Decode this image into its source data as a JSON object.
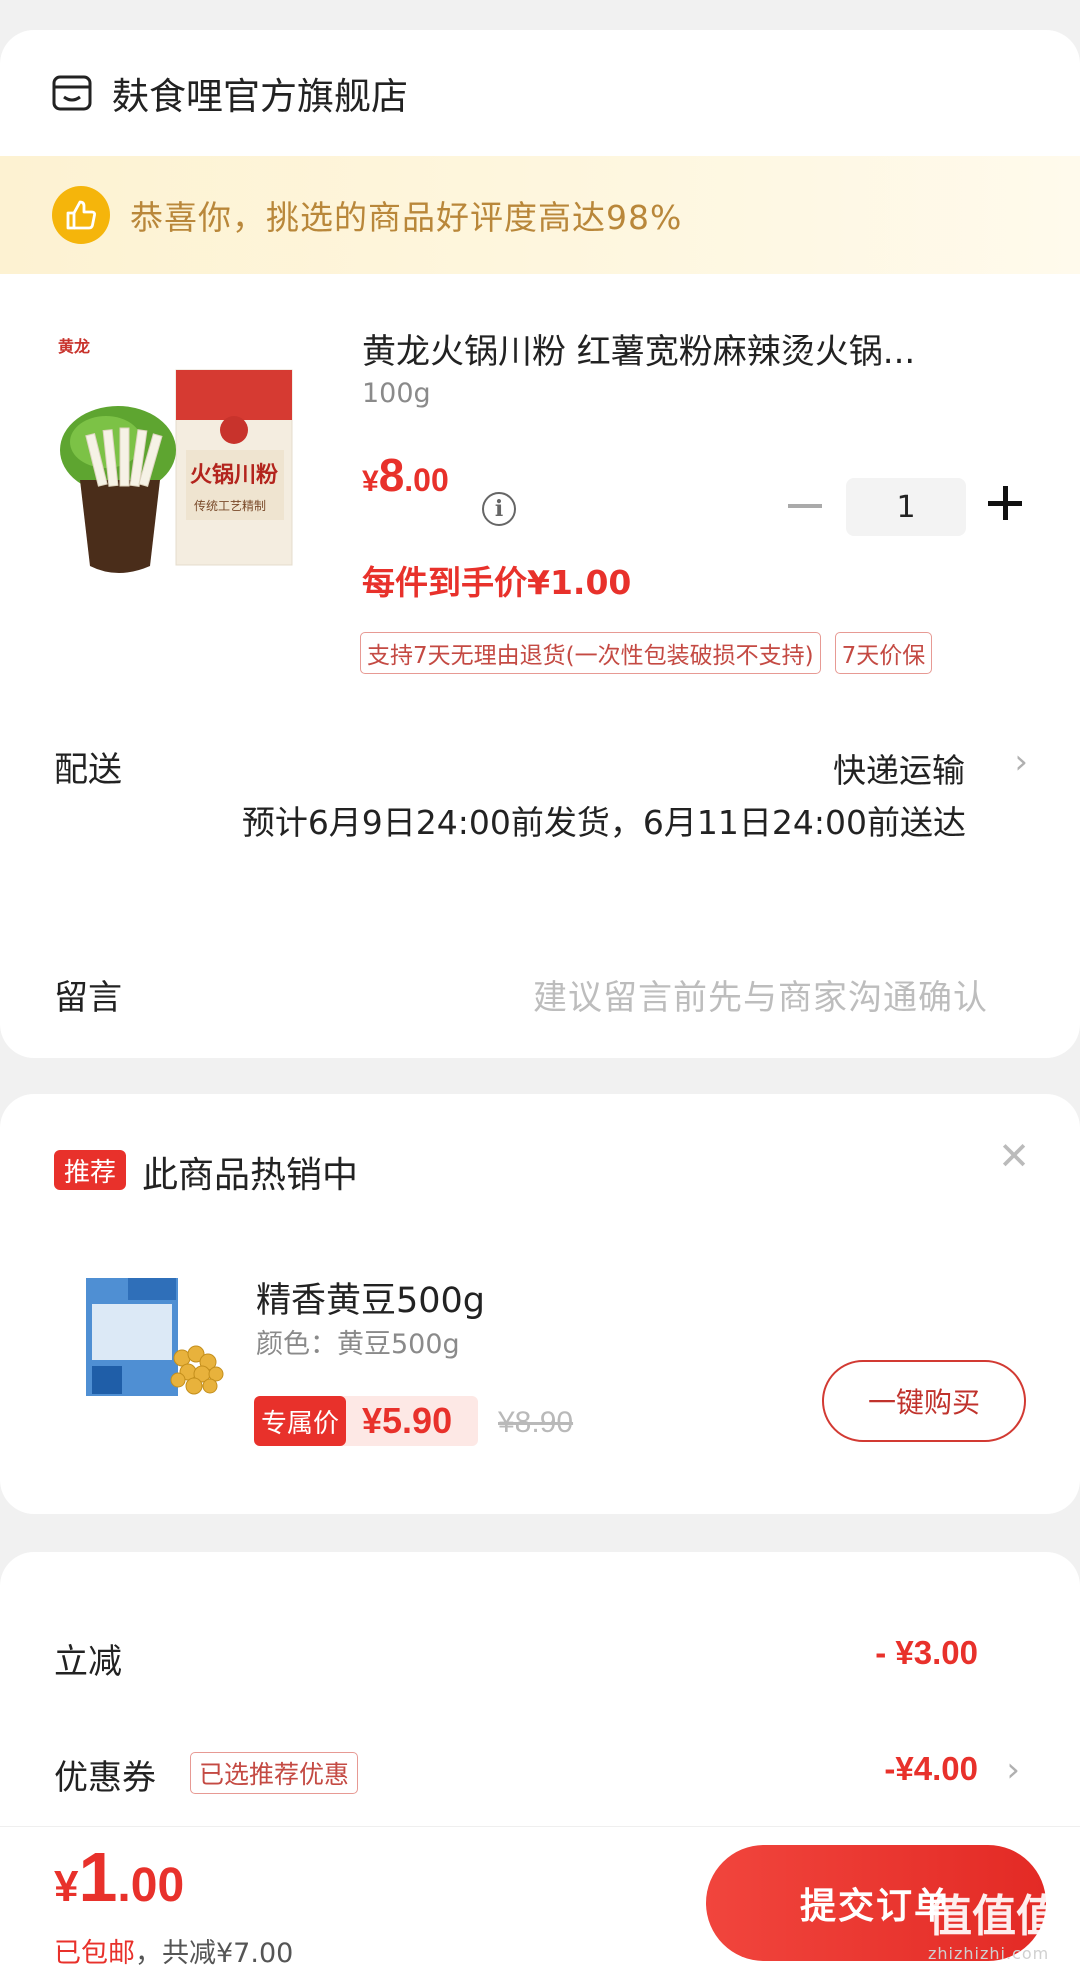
{
  "store": {
    "name": "麸食哩官方旗舰店",
    "icon": "store-icon"
  },
  "praise_banner": {
    "text": "恭喜你，挑选的商品好评度高达98%",
    "icon": "thumbs-up-icon"
  },
  "product": {
    "brand_logo": "黄龙",
    "package_text": "火锅川粉",
    "package_sub": "传统工艺精制",
    "title": "黄龙火锅川粉 红薯宽粉麻辣烫火锅...",
    "spec": "100g",
    "price_currency": "¥",
    "price_int": "8",
    "price_dec": ".00",
    "quantity": "1",
    "final_price": "每件到手价¥1.00",
    "tags": [
      "支持7天无理由退货(一次性包装破损不支持)",
      "7天价保"
    ]
  },
  "delivery": {
    "label": "配送",
    "method": "快递运输",
    "estimate": "预计6月9日24:00前发货，6月11日24:00前送达"
  },
  "remark": {
    "label": "留言",
    "placeholder": "建议留言前先与商家沟通确认"
  },
  "recommend": {
    "badge": "推荐",
    "title": "此商品热销中",
    "item": {
      "name": "精香黄豆500g",
      "spec": "颜色：黄豆500g",
      "exclusive_label": "专属价",
      "price": "¥5.90",
      "old_price": "¥8.90",
      "buy_label": "一键购买"
    }
  },
  "discounts": {
    "instant_label": "立减",
    "instant_value": "- ¥3.00",
    "coupon_label": "优惠券",
    "coupon_tag": "已选推荐优惠",
    "coupon_value": "-¥4.00"
  },
  "footer": {
    "total_currency": "¥",
    "total_int": "1",
    "total_dec": ".00",
    "shipping": "已包邮",
    "saved": "，共减¥7.00",
    "submit_label": "提交订单"
  },
  "watermark": {
    "text": "值值值",
    "sub": "zhizhizhi.com"
  },
  "colors": {
    "accent": "#e8312b",
    "banner_text": "#b9873a",
    "banner_bg": "#fdf2d2"
  }
}
